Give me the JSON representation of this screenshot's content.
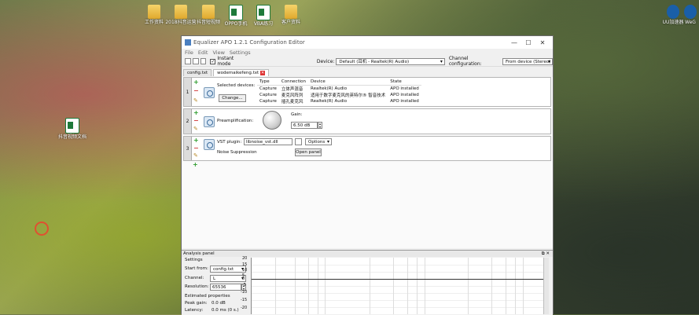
{
  "desktop": {
    "icons": [
      {
        "label": "工作资料"
      },
      {
        "label": "2018抖音运营"
      },
      {
        "label": "抖音短视频"
      },
      {
        "label": "OPPO手机"
      },
      {
        "label": "VBA练习"
      },
      {
        "label": "客户资料"
      },
      {
        "label": "抖音视频文档"
      },
      {
        "label": "UU加速器"
      },
      {
        "label": "WeG"
      }
    ]
  },
  "window": {
    "title": "Equalizer APO 1.2.1 Configuration Editor",
    "menu": [
      "File",
      "Edit",
      "View",
      "Settings"
    ],
    "toolbar": {
      "instant_mode_label": "Instant mode",
      "instant_mode_checked": "✓",
      "device_label": "Device:",
      "device_value": "Default (耳机 - Realtek(R) Audio)",
      "channel_config_label": "Channel configuration:",
      "channel_config_value": "From device (Stereo)"
    },
    "tabs": [
      {
        "label": "config.txt"
      },
      {
        "label": "wodemaikefeng.txt"
      }
    ],
    "filters": {
      "f1": {
        "num": "1",
        "selected_devices_label": "Selected devices:",
        "change_button": "Change...",
        "columns": [
          "Type",
          "Connection",
          "Device",
          "State"
        ],
        "rows": [
          [
            "Capture",
            "立体声混音",
            "Realtek(R) Audio",
            "APO installed"
          ],
          [
            "Capture",
            "麦克风阵列",
            "适用于数字麦克风的英特尔® 智音技术",
            "APO installed"
          ],
          [
            "Capture",
            "插孔麦克风",
            "Realtek(R) Audio",
            "APO installed"
          ]
        ]
      },
      "f2": {
        "num": "2",
        "label": "Preamplification:",
        "gain_label": "Gain:",
        "gain_value": "6.50 dB"
      },
      "f3": {
        "num": "3",
        "vst_label": "VST plugin:",
        "vst_value": "libnoise_vst.dll",
        "options_label": "Options",
        "subtitle": "Noise Suppression",
        "open_panel": "Open panel"
      }
    },
    "controls": {
      "plus": "+",
      "minus": "−",
      "edit": "✎"
    },
    "analysis": {
      "title": "Analysis panel",
      "settings_label": "Settings",
      "start_from_label": "Start from:",
      "start_from_value": "config.txt",
      "channel_label": "Channel:",
      "channel_value": "L",
      "resolution_label": "Resolution:",
      "resolution_value": "65536",
      "estimated_label": "Estimated properties",
      "peak_gain_label": "Peak gain:",
      "peak_gain_value": "0.0 dB",
      "latency_label": "Latency:",
      "latency_value": "0.0 ms (0 s.)",
      "y_ticks": [
        "20",
        "15",
        "10",
        "5",
        "0",
        "-5",
        "-10",
        "-15",
        "-20"
      ]
    }
  }
}
